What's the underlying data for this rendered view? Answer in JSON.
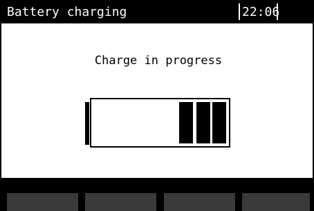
{
  "header": {
    "title": "Battery charging",
    "clock": "22:06"
  },
  "main": {
    "status_text": "Charge in progress",
    "battery": {
      "charge_bars_filled": 3
    }
  },
  "softkeys": [
    {
      "label": ""
    },
    {
      "label": ""
    },
    {
      "label": ""
    },
    {
      "label": ""
    }
  ],
  "colors": {
    "background": "#ffffff",
    "foreground": "#000000",
    "softkey": "#3a3a3a"
  }
}
